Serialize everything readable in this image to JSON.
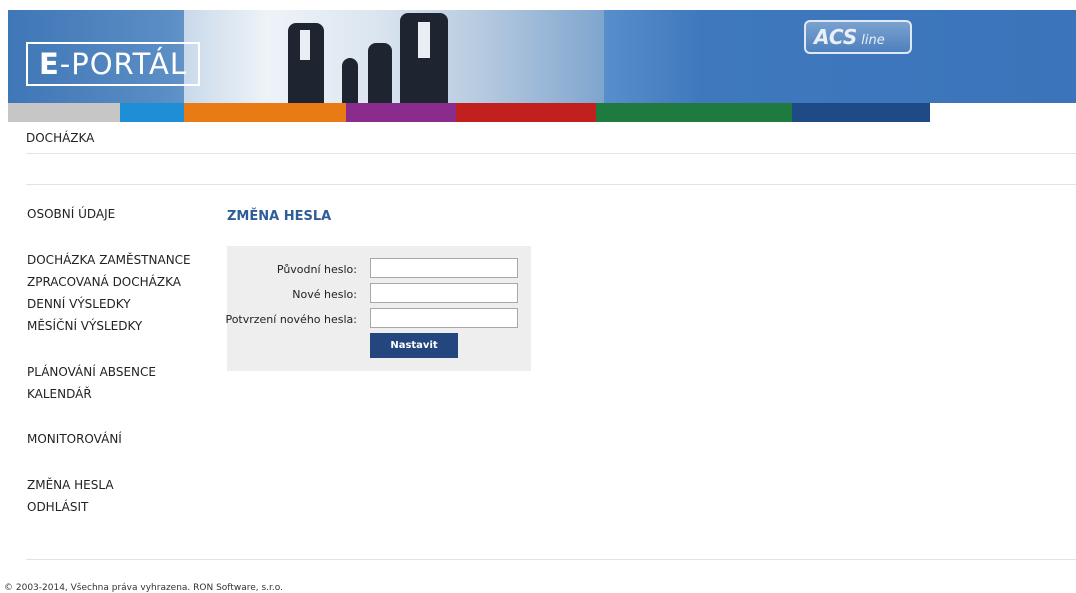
{
  "header": {
    "logo_text_bold": "E",
    "logo_text_rest": "-PORTÁL",
    "brand_badge": "ACS",
    "brand_badge_sub": "line",
    "stripe_colors": [
      "#c6c6c6",
      "#1e8fd6",
      "#e87b14",
      "#8a2b8e",
      "#c2201f",
      "#1e7a3e",
      "#1e4b86"
    ]
  },
  "topnav": {
    "item": "DOCHÁZKA"
  },
  "sidebar": {
    "items": [
      "OSOBNÍ ÚDAJE",
      "DOCHÁZKA ZAMĚSTNANCE",
      "ZPRACOVANÁ DOCHÁZKA",
      "DENNÍ VÝSLEDKY",
      "MĚSÍČNÍ VÝSLEDKY",
      "PLÁNOVÁNÍ ABSENCE",
      "KALENDÁŘ",
      "MONITOROVÁNÍ",
      "ZMĚNA HESLA",
      "ODHLÁSIT"
    ]
  },
  "main": {
    "title": "ZMĚNA HESLA",
    "form": {
      "old_label": "Původní heslo:",
      "old_value": "",
      "new_label": "Nové heslo:",
      "new_value": "",
      "confirm_label": "Potvrzení nového hesla:",
      "confirm_value": "",
      "submit_label": "Nastavit"
    }
  },
  "footer": {
    "text": "© 2003-2014, Všechna práva vyhrazena. RON Software, s.r.o."
  }
}
